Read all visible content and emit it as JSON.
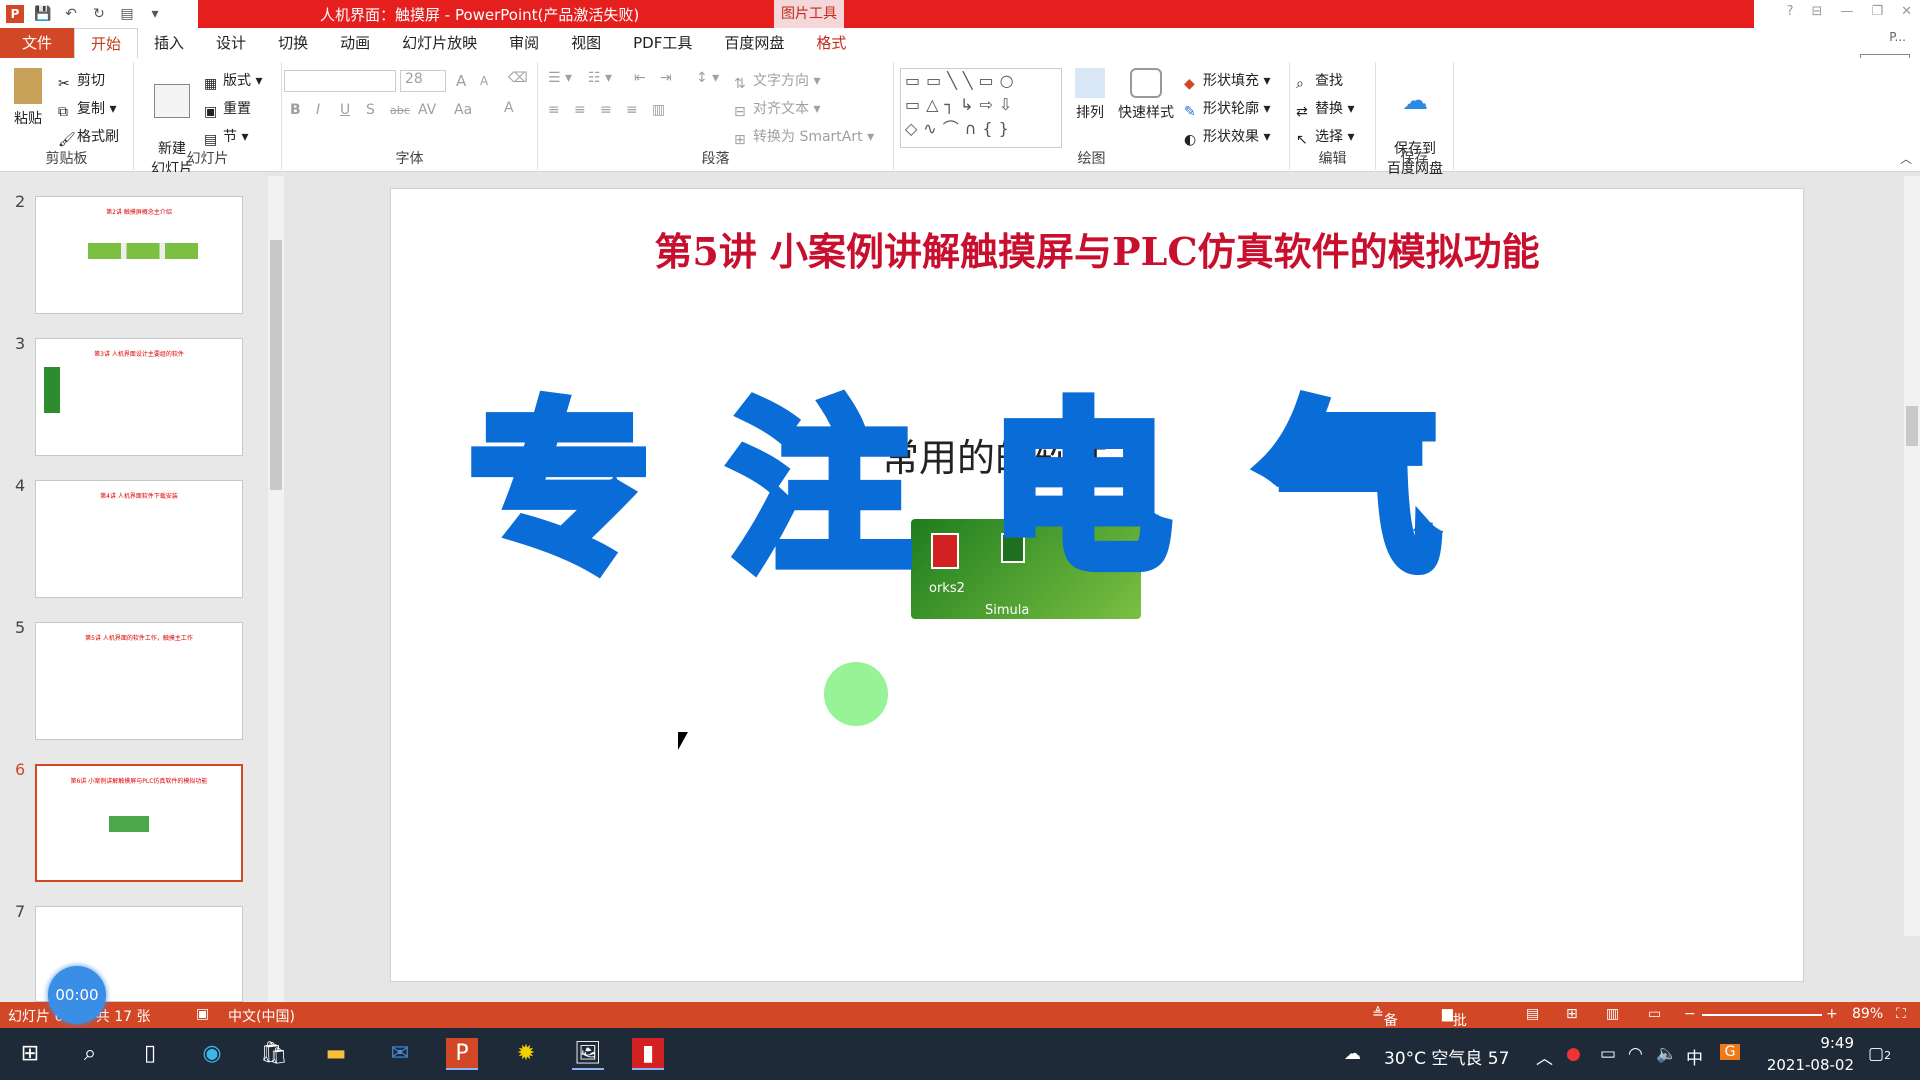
{
  "window": {
    "title": "人机界面：触摸屏 - PowerPoint(产品激活失败)",
    "context_tool": "图片工具",
    "side_label": "P...",
    "start_button": "开始"
  },
  "tabs": [
    "文件",
    "开始",
    "插入",
    "设计",
    "切换",
    "动画",
    "幻灯片放映",
    "审阅",
    "视图",
    "PDF工具",
    "百度网盘",
    "格式"
  ],
  "ribbon": {
    "clipboard": {
      "paste": "粘贴",
      "cut": "剪切",
      "copy": "复制",
      "format_painter": "格式刷",
      "label": "剪贴板"
    },
    "slides": {
      "new_slide": "新建\n幻灯片",
      "layout": "版式",
      "reset": "重置",
      "section": "节",
      "label": "幻灯片"
    },
    "font": {
      "size": "28",
      "label": "字体",
      "bold": "B",
      "italic": "I",
      "underline": "U",
      "shadow": "S",
      "strike": "abc",
      "spacing": "AV",
      "case": "Aa",
      "color": "A",
      "grow": "A",
      "shrink": "A"
    },
    "paragraph": {
      "text_direction": "文字方向",
      "align_text": "对齐文本",
      "smartart": "转换为 SmartArt",
      "label": "段落"
    },
    "drawing": {
      "arrange": "排列",
      "quick_styles": "快速样式",
      "shape_fill": "形状填充",
      "shape_outline": "形状轮廓",
      "shape_effects": "形状效果",
      "label": "绘图"
    },
    "editing": {
      "find": "查找",
      "replace": "替换",
      "select": "选择",
      "label": "编辑"
    },
    "save": {
      "save_to_baidu": "保存到\n百度网盘",
      "label": "保存"
    }
  },
  "thumbnails": [
    {
      "num": "2",
      "title": "第2讲  触摸屏概念主介绍"
    },
    {
      "num": "3",
      "title": "第3讲  人机界面设计主要组的软件"
    },
    {
      "num": "4",
      "title": "第4讲  人机界面软件下载安装"
    },
    {
      "num": "5",
      "title": "第5讲  人机界面的软件工作，触摸主工作"
    },
    {
      "num": "6",
      "title": "第6讲  小案例讲解触摸屏与PLC仿真软件的模拟功能"
    },
    {
      "num": "7",
      "title": ""
    }
  ],
  "slide": {
    "title": "第5讲  小案例讲解触摸屏与PLC仿真软件的模拟功能",
    "subtitle_fragment": "常用的的软件",
    "image_text_1": "orks2",
    "image_text_2": "Simula",
    "watermark": [
      "专",
      "注",
      "电",
      "气"
    ]
  },
  "status": {
    "slide_info": "幻灯片 6 张，共 17 张",
    "language": "中文(中国)",
    "notes": "备注",
    "comments": "批注",
    "zoom": "89%",
    "timer": "00:00"
  },
  "taskbar": {
    "weather": "30°C 空气良 57",
    "ime": "中",
    "time": "9:49",
    "date": "2021-08-02",
    "notifications": "2"
  },
  "colors": {
    "accent": "#d24726",
    "title_red": "#c8102e",
    "watermark_fill": "#aef0ff",
    "watermark_stroke": "#0a6cd6"
  }
}
